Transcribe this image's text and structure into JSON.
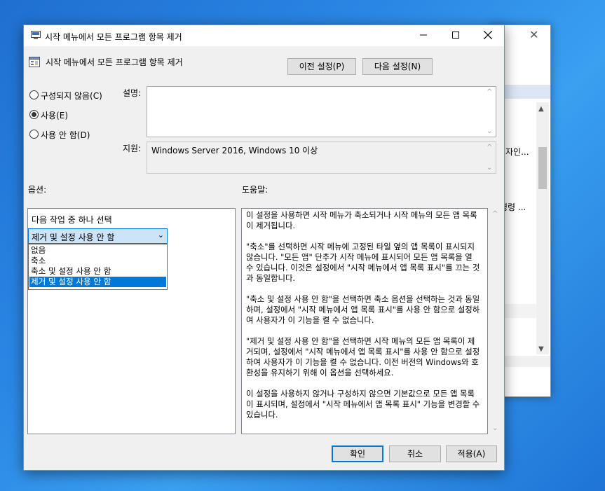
{
  "background_window": {
    "text_1": "자인...",
    "text_2": "명령 ..."
  },
  "dialog": {
    "title": "시작 메뉴에서 모든 프로그램 항목 제거",
    "header_title": "시작 메뉴에서 모든 프로그램 항목 제거",
    "prev_setting_label": "이전 설정(P)",
    "next_setting_label": "다음 설정(N)",
    "radios": [
      {
        "label": "구성되지 않음(C)",
        "checked": false
      },
      {
        "label": "사용(E)",
        "checked": true
      },
      {
        "label": "사용 안 함(D)",
        "checked": false
      }
    ],
    "comment_label": "설명:",
    "comment_value": "",
    "supported_label": "지원:",
    "supported_value": "Windows Server 2016, Windows 10 이상",
    "options_label": "옵션:",
    "help_label": "도움말:",
    "options": {
      "prompt": "다음 작업 중 하나 선택",
      "selected": "제거 및 설정 사용 안 함",
      "items": [
        "없음",
        "축소",
        "축소 및 설정 사용 안 함",
        "제거 및 설정 사용 안 함"
      ]
    },
    "help_paragraphs": [
      "이 설정을 사용하면 시작 메뉴가 축소되거나 시작 메뉴의 모든 앱 목록이 제거됩니다.",
      "\"축소\"를 선택하면 시작 메뉴에 고정된 타일 옆의 앱 목록이 표시되지 않습니다. \"모든 앱\" 단추가 시작 메뉴에 표시되어 모든 앱 목록을 열 수 있습니다. 이것은 설정에서 \"시작 메뉴에서 앱 목록 표시\"를 끄는 것과 동일합니다.",
      "\"축소 및 설정 사용 안 함\"을 선택하면 축소 옵션을 선택하는 것과 동일하며, 설정에서 \"시작 메뉴에서 앱 목록 표시\"를 사용 안 함으로 설정하여 사용자가 이 기능을 켤 수 없습니다.",
      "\"제거 및 설정 사용 안 함\"을 선택하면 시작 메뉴의 모든 앱 목록이 제거되며, 설정에서 \"시작 메뉴에서 앱 목록 표시\"를 사용 안 함으로 설정하여 사용자가 이 기능을 켤 수 없습니다. 이전 버전의 Windows와 호환성을 유지하기 위해 이 옵션을 선택하세요.",
      "이 설정을 사용하지 않거나 구성하지 않으면 기본값으로 모든 앱 목록이 표시되며, 설정에서 \"시작 메뉴에서 앱 목록 표시\" 기능을 변경할 수 있습니다."
    ],
    "ok_label": "확인",
    "cancel_label": "취소",
    "apply_label": "적용(A)"
  }
}
